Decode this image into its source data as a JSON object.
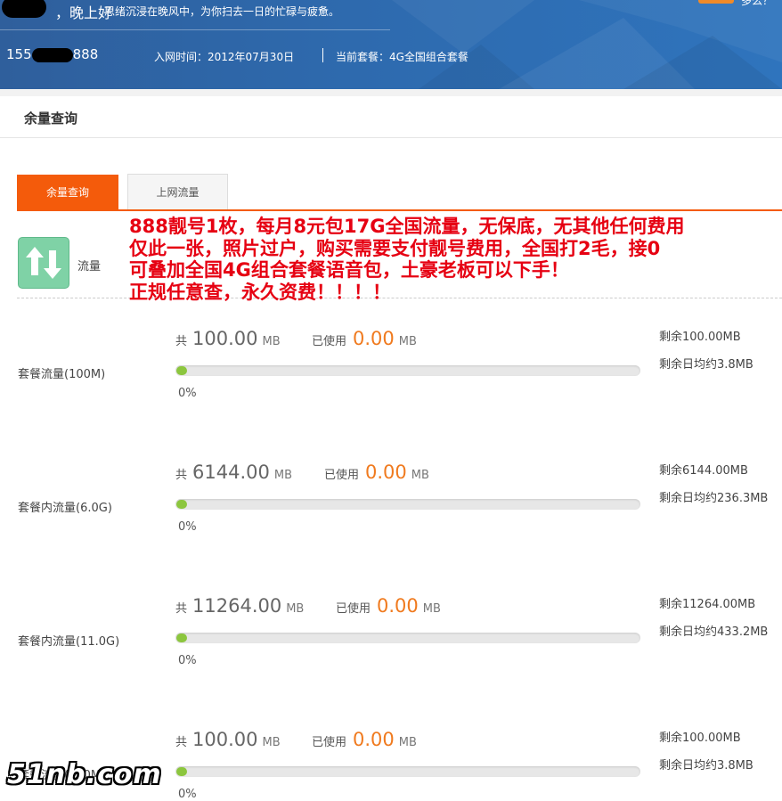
{
  "header": {
    "greeting": "，晚上好",
    "greeting_sub": "思绪沉浸在晚风中，为你扫去一日的忙碌与疲惫。",
    "phone_prefix": "155",
    "phone_suffix": "888",
    "join_date": "入网时间：2012年07月30日",
    "current_plan": "当前套餐：4G全国组合套餐",
    "top_right_text": "多么？"
  },
  "section": {
    "title": "余量查询"
  },
  "tabs": [
    {
      "label": "余量查询",
      "active": true
    },
    {
      "label": "上网流量",
      "active": false
    }
  ],
  "category": {
    "icon": "up-down-arrows-icon",
    "label": "流量"
  },
  "ad_text": [
    "888靓号1枚，每月8元包17G全国流量，无保底，无其他任何费用",
    "仅此一张，照片过户，购买需要支付靓号费用，全国打2毛，接0",
    "可叠加全国4G组合套餐语音包，土豪老板可以下手！",
    "正规任意查，永久资费！！！！"
  ],
  "labels": {
    "total": "共",
    "used": "已使用",
    "unit": "MB"
  },
  "rows": [
    {
      "name": "套餐流量(100M)",
      "total": "100.00",
      "used": "0.00",
      "percent": "0%",
      "remain": "剩余100.00MB",
      "daily": "剩余日均约3.8MB",
      "progress": 0
    },
    {
      "name": "套餐内流量(6.0G)",
      "total": "6144.00",
      "used": "0.00",
      "percent": "0%",
      "remain": "剩余6144.00MB",
      "daily": "剩余日均约236.3MB",
      "progress": 0
    },
    {
      "name": "套餐内流量(11.0G)",
      "total": "11264.00",
      "used": "0.00",
      "percent": "0%",
      "remain": "剩余11264.00MB",
      "daily": "剩余日均约433.2MB",
      "progress": 0
    },
    {
      "name": "套餐流量(100M)",
      "total": "100.00",
      "used": "0.00",
      "percent": "0%",
      "remain": "剩余100.00MB",
      "daily": "剩余日均约3.8MB",
      "progress": 0
    }
  ],
  "watermark": "51nb.com",
  "colors": {
    "header_blue": "#2e6aae",
    "accent_orange": "#f45b0b",
    "ad_red": "#e60012",
    "used_orange": "#f07a1e",
    "progress_green": "#8cc63e",
    "icon_green": "#7fd2a6"
  }
}
